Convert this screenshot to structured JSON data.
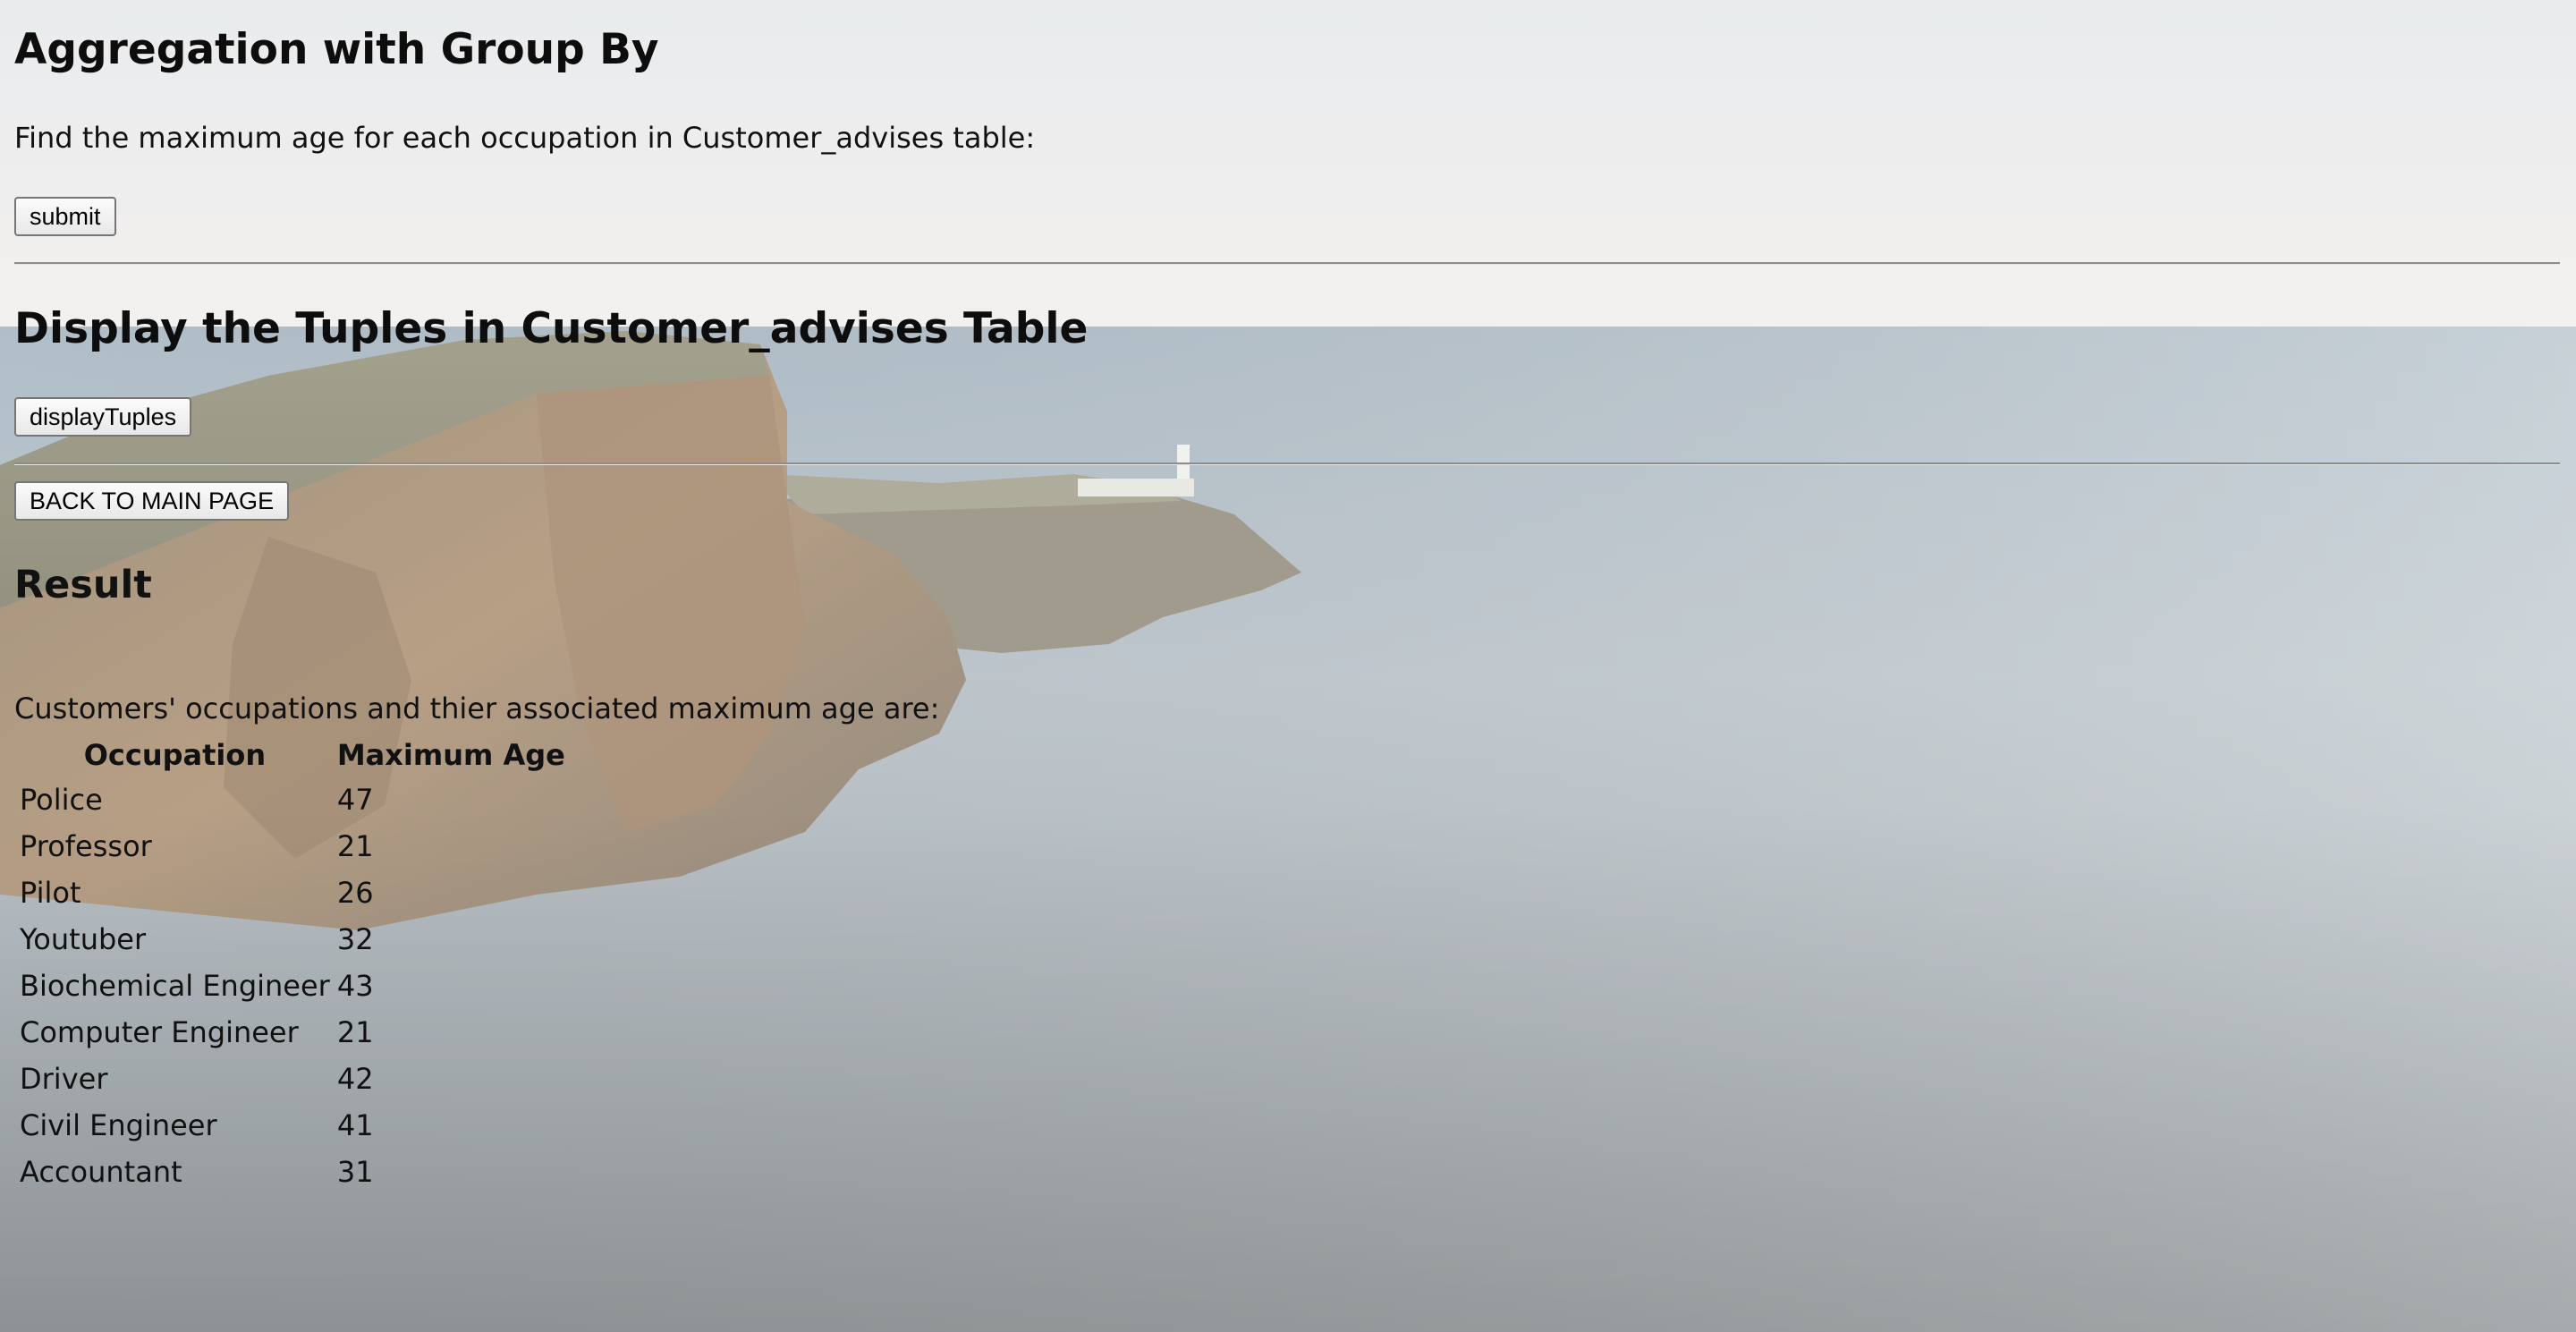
{
  "aggregation": {
    "title": "Aggregation with Group By",
    "description": "Find the maximum age for each occupation in Customer_advises table:",
    "submit_label": "submit"
  },
  "display": {
    "title": "Display the Tuples in Customer_advises Table",
    "button_label": "displayTuples"
  },
  "nav": {
    "back_label": "BACK TO MAIN PAGE"
  },
  "result": {
    "title": "Result",
    "caption": "Customers' occupations and thier associated maximum age are:",
    "columns": [
      "Occupation",
      "Maximum Age"
    ],
    "rows": [
      {
        "occupation": "Police",
        "max_age": "47"
      },
      {
        "occupation": "Professor",
        "max_age": "21"
      },
      {
        "occupation": "Pilot",
        "max_age": "26"
      },
      {
        "occupation": "Youtuber",
        "max_age": "32"
      },
      {
        "occupation": "Biochemical Engineer",
        "max_age": "43"
      },
      {
        "occupation": "Computer Engineer",
        "max_age": "21"
      },
      {
        "occupation": "Driver",
        "max_age": "42"
      },
      {
        "occupation": "Civil Engineer",
        "max_age": "41"
      },
      {
        "occupation": "Accountant",
        "max_age": "31"
      }
    ]
  }
}
